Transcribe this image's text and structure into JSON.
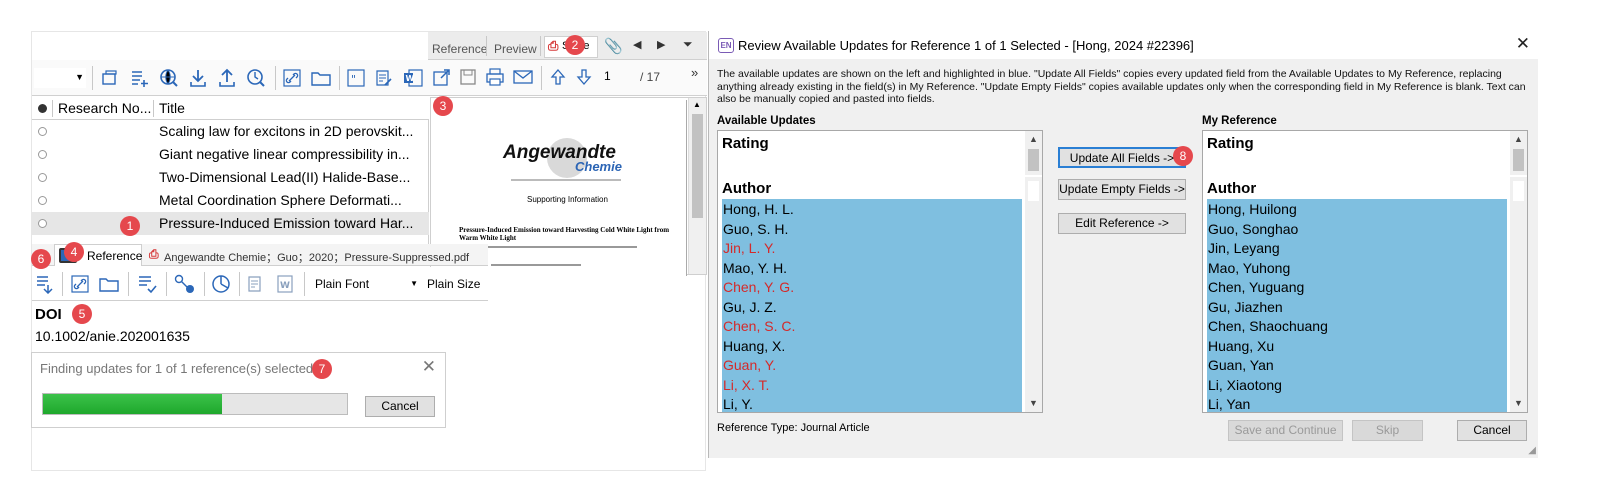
{
  "left": {
    "tabs": {
      "reference": "Reference",
      "preview": "Preview",
      "pdf": "S Pre"
    },
    "page": {
      "current": "1",
      "total": "/ 17"
    },
    "list_columns": {
      "research_notes": "Research No...",
      "title": "Title"
    },
    "rows": [
      {
        "title": "Scaling law for excitons in 2D perovskit..."
      },
      {
        "title": "Giant negative linear compressibility in..."
      },
      {
        "title": "Two-Dimensional Lead(II) Halide-Base..."
      },
      {
        "title": "Metal Coordination Sphere Deformati..."
      },
      {
        "title": "Pressure-Induced Emission toward Har..."
      }
    ],
    "preview_doc": {
      "journal1": "Angewandte",
      "journal2": "Chemie",
      "supporting": "Supporting Information",
      "doc_title": "Pressure-Induced Emission toward Harvesting Cold White Light from Warm White Light"
    },
    "bottom_tabs": {
      "reference": "Reference",
      "pdf": "Angewandte Chemie；Guo；2020；Pressure-Suppressed.pdf"
    },
    "font": "Plain Font",
    "size": "Plain Size",
    "doi_label": "DOI",
    "doi_value": "10.1002/anie.202001635"
  },
  "progress": {
    "message": "Finding updates for 1 of 1 reference(s) selected...",
    "cancel": "Cancel",
    "percent": 0.59
  },
  "dialog": {
    "title": "Review Available Updates for Reference 1 of 1 Selected - [Hong, 2024 #22396]",
    "description": "The available updates are shown on the left and highlighted in blue. \"Update All Fields\" copies every updated field from the Available Updates to My Reference, replacing anything already existing in the field(s) in My Reference. \"Update Empty Fields\" copies available updates only when the corresponding field in My Reference is blank. Text can also be manually copied and pasted into fields.",
    "available_label": "Available Updates",
    "my_label": "My Reference",
    "rating_label": "Rating",
    "author_label": "Author",
    "available_authors": [
      {
        "name": "Hong, H. L.",
        "color": "#000000"
      },
      {
        "name": "Guo, S. H.",
        "color": "#000000"
      },
      {
        "name": "Jin, L. Y.",
        "color": "#d42a2a"
      },
      {
        "name": "Mao, Y. H.",
        "color": "#000000"
      },
      {
        "name": "Chen, Y. G.",
        "color": "#d42a2a"
      },
      {
        "name": "Gu, J. Z.",
        "color": "#000000"
      },
      {
        "name": "Chen, S. C.",
        "color": "#d42a2a"
      },
      {
        "name": "Huang, X.",
        "color": "#000000"
      },
      {
        "name": "Guan, Y.",
        "color": "#d42a2a"
      },
      {
        "name": "Li, X. T.",
        "color": "#d42a2a"
      },
      {
        "name": "Li, Y.",
        "color": "#000000"
      }
    ],
    "my_authors": [
      {
        "name": "Hong, Huilong"
      },
      {
        "name": "Guo, Songhao"
      },
      {
        "name": "Jin, Leyang"
      },
      {
        "name": "Mao, Yuhong"
      },
      {
        "name": "Chen, Yuguang"
      },
      {
        "name": "Gu, Jiazhen"
      },
      {
        "name": "Chen, Shaochuang"
      },
      {
        "name": "Huang, Xu"
      },
      {
        "name": "Guan, Yan"
      },
      {
        "name": "Li, Xiaotong"
      },
      {
        "name": "Li, Yan"
      }
    ],
    "buttons": {
      "update_all": "Update All Fields ->",
      "update_empty": "Update Empty Fields ->",
      "edit_ref": "Edit Reference ->",
      "save_continue": "Save and Continue",
      "skip": "Skip",
      "cancel": "Cancel"
    },
    "ref_type": "Reference Type: Journal Article"
  },
  "badges": {
    "b1": "1",
    "b2": "2",
    "b3": "3",
    "b4": "4",
    "b5": "5",
    "b6": "6",
    "b7": "7",
    "b8": "8"
  }
}
